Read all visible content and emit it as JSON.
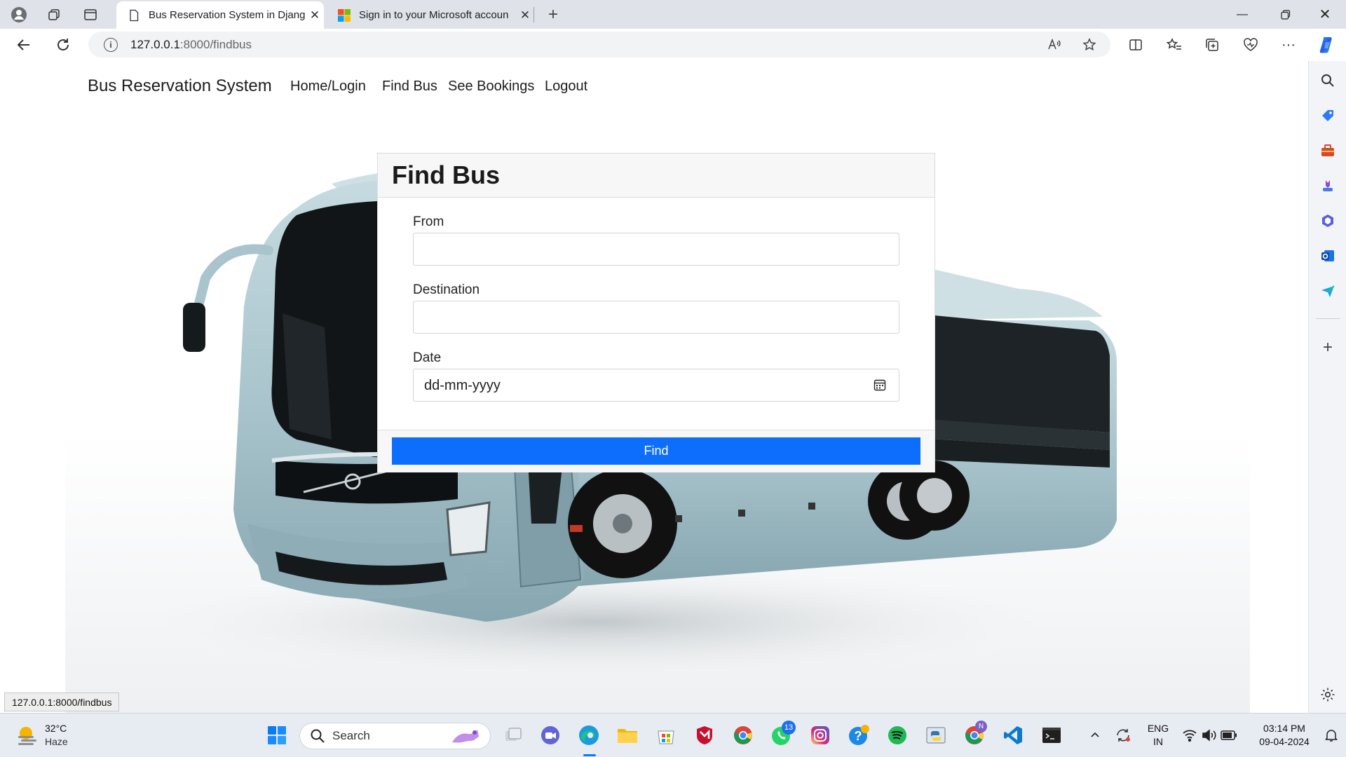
{
  "browser": {
    "tabs": [
      {
        "title": "Bus Reservation System in Djang",
        "active": true
      },
      {
        "title": "Sign in to your Microsoft accoun",
        "active": false
      }
    ],
    "url_host": "127.0.0.1",
    "url_path": ":8000/findbus"
  },
  "navbar": {
    "brand": "Bus Reservation System",
    "links": [
      "Home/Login",
      "Find Bus",
      "See Bookings",
      "Logout"
    ]
  },
  "card": {
    "title": "Find Bus",
    "from_label": "From",
    "destination_label": "Destination",
    "date_label": "Date",
    "date_placeholder": "dd-mm-yyyy",
    "button_label": "Find"
  },
  "status_url": "127.0.0.1:8000/findbus",
  "taskbar": {
    "weather_temp": "32°C",
    "weather_desc": "Haze",
    "search_label": "Search",
    "whatsapp_badge": "13",
    "chrome_profile_badge": "N",
    "lang_top": "ENG",
    "lang_bottom": "IN",
    "time": "03:14 PM",
    "date": "09-04-2024"
  },
  "colors": {
    "primary_button": "#0d6efd",
    "bus_body": "#a9c4cc"
  }
}
